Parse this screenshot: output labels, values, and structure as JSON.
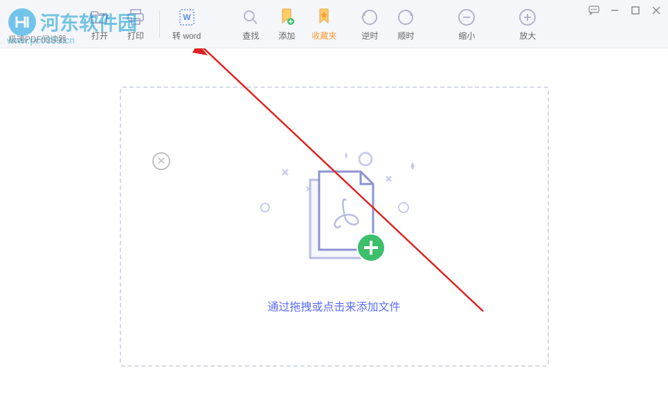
{
  "watermark": {
    "title": "河东软件园",
    "url": "www.pc0359.cn"
  },
  "app": {
    "title_left": "极速PDF阅读器",
    "title_open": "打开"
  },
  "toolbar": {
    "print": "打印",
    "to_word": "转 word",
    "find": "查找",
    "add": "添加",
    "favorites": "收藏夹",
    "ccw": "逆时",
    "cw": "顺时",
    "zoom_out": "缩小",
    "zoom_in": "放大"
  },
  "dropzone": {
    "prompt": "通过拖拽或点击来添加文件"
  },
  "colors": {
    "accent": "#5b6cff",
    "highlight": "#ff9933",
    "green": "#3dbf6c"
  }
}
